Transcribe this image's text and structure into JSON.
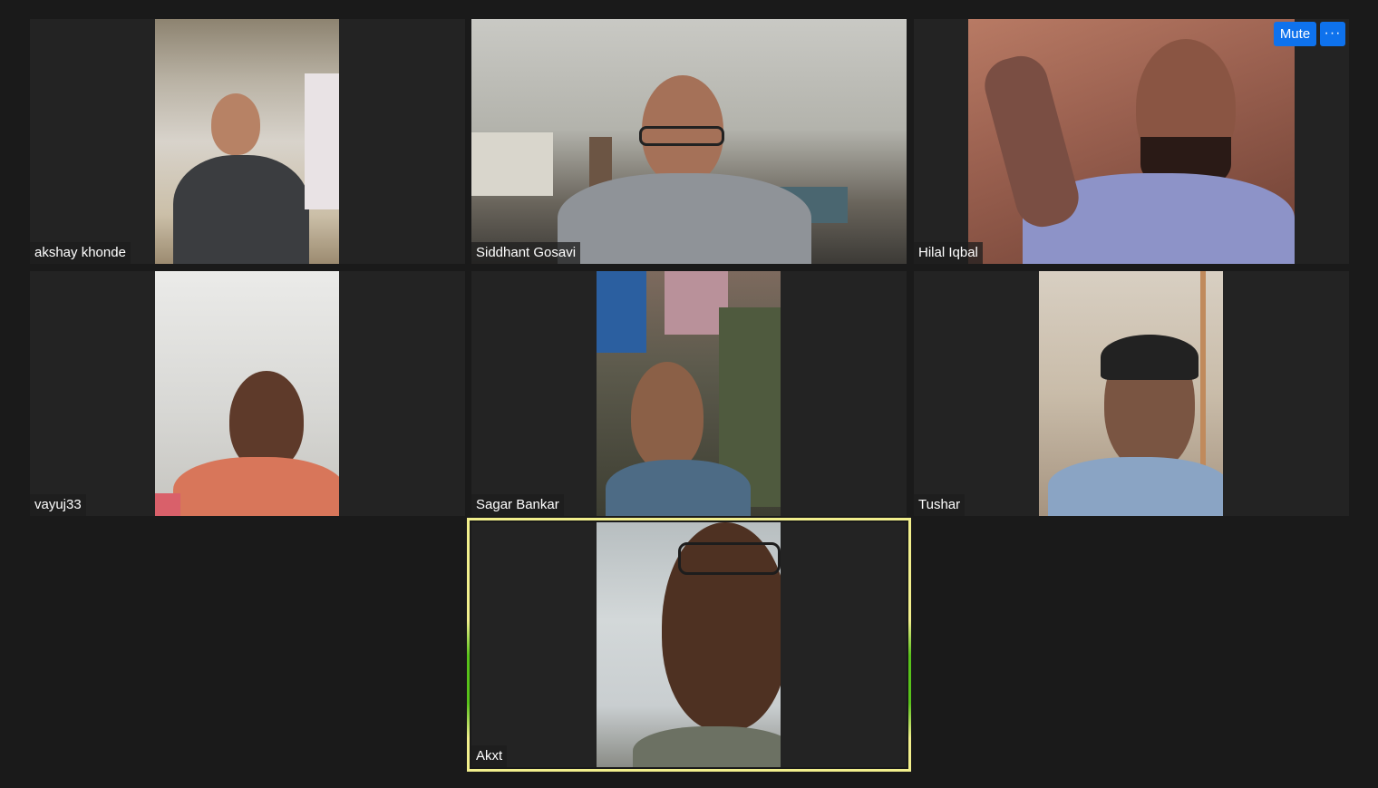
{
  "controls": {
    "mute_label": "Mute",
    "more_label": "···"
  },
  "participants": [
    {
      "name": "akshay khonde"
    },
    {
      "name": "Siddhant Gosavi"
    },
    {
      "name": "Hilal Iqbal"
    },
    {
      "name": "vayuj33"
    },
    {
      "name": "Sagar Bankar"
    },
    {
      "name": "Tushar"
    },
    {
      "name": "Akxt",
      "active_speaker": true
    }
  ],
  "colors": {
    "background": "#1a1a1a",
    "tile": "#232323",
    "active_speaker_border": "#f2ef8d",
    "button": "#0e72ed"
  }
}
